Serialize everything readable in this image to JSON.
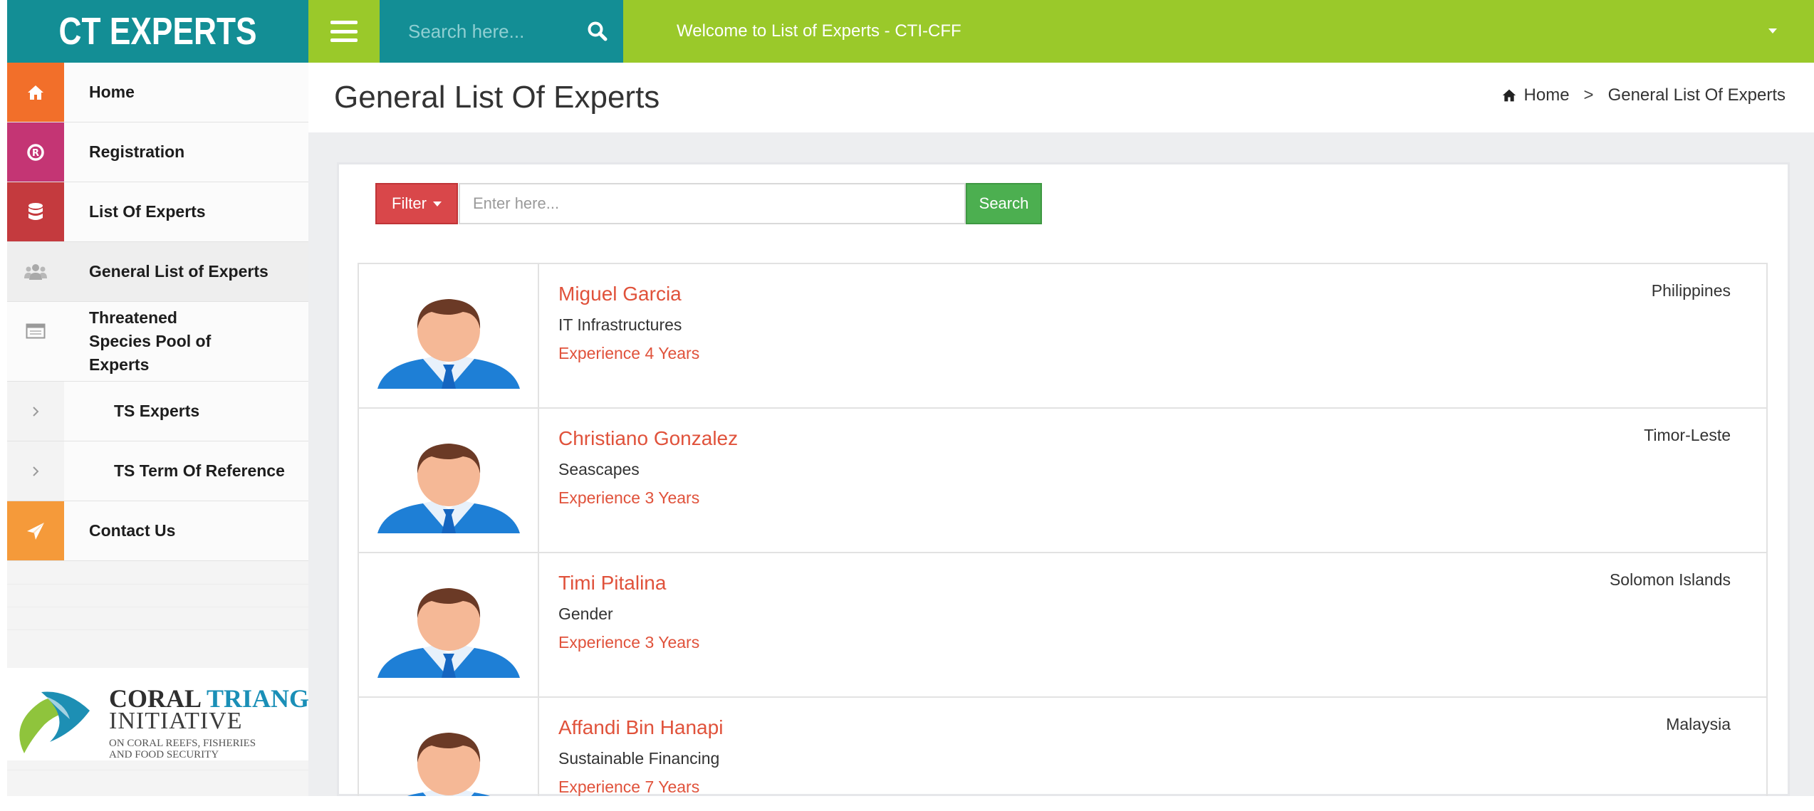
{
  "app": {
    "logo_text": "CT EXPERTS",
    "search_placeholder": "Search here...",
    "welcome_text": "Welcome to List of Experts - CTI-CFF"
  },
  "sidebar": {
    "items": [
      {
        "label": "Home",
        "icon": "home-icon",
        "color": "#f26f2a"
      },
      {
        "label": "Registration",
        "icon": "registered-icon",
        "color": "#c43574"
      },
      {
        "label": "List Of Experts",
        "icon": "database-icon",
        "color": "#c43a3e"
      },
      {
        "label": "General List of Experts",
        "icon": "users-icon",
        "color": "#eeeeee"
      },
      {
        "label": "Threatened Species Pool of Experts",
        "icon": "window-icon",
        "color": "#fbfbfb"
      },
      {
        "label": "TS Experts",
        "icon": "chevron-right-icon",
        "color": "#f3f3f3"
      },
      {
        "label": "TS Term Of Reference",
        "icon": "chevron-right-icon",
        "color": "#f3f3f3"
      },
      {
        "label": "Contact Us",
        "icon": "send-icon",
        "color": "#f59a3a"
      }
    ],
    "org_logo": {
      "line1_a": "CORAL ",
      "line1_b": "TRIANGLE",
      "line2": "INITIATIVE",
      "line3": "ON CORAL REEFS, FISHERIES AND FOOD SECURITY"
    }
  },
  "header": {
    "page_title": "General List Of Experts",
    "breadcrumb": {
      "home": "Home",
      "current": "General List Of Experts"
    }
  },
  "filter": {
    "button_label": "Filter",
    "placeholder": "Enter here...",
    "search_label": "Search"
  },
  "experts": [
    {
      "name": "Miguel Garcia",
      "field": "IT Infrastructures",
      "experience": "Experience  4 Years",
      "country": "Philippines"
    },
    {
      "name": "Christiano Gonzalez",
      "field": "Seascapes",
      "experience": "Experience  3 Years",
      "country": "Timor-Leste"
    },
    {
      "name": "Timi Pitalina",
      "field": "Gender",
      "experience": "Experience  3 Years",
      "country": "Solomon Islands"
    },
    {
      "name": "Affandi Bin Hanapi",
      "field": "Sustainable Financing",
      "experience": "Experience  7 Years",
      "country": "Malaysia"
    }
  ],
  "colors": {
    "teal": "#138e95",
    "lime": "#9ac92a",
    "accent_name": "#e0523b",
    "filter_red": "#d9474a",
    "search_green": "#4caf50"
  }
}
